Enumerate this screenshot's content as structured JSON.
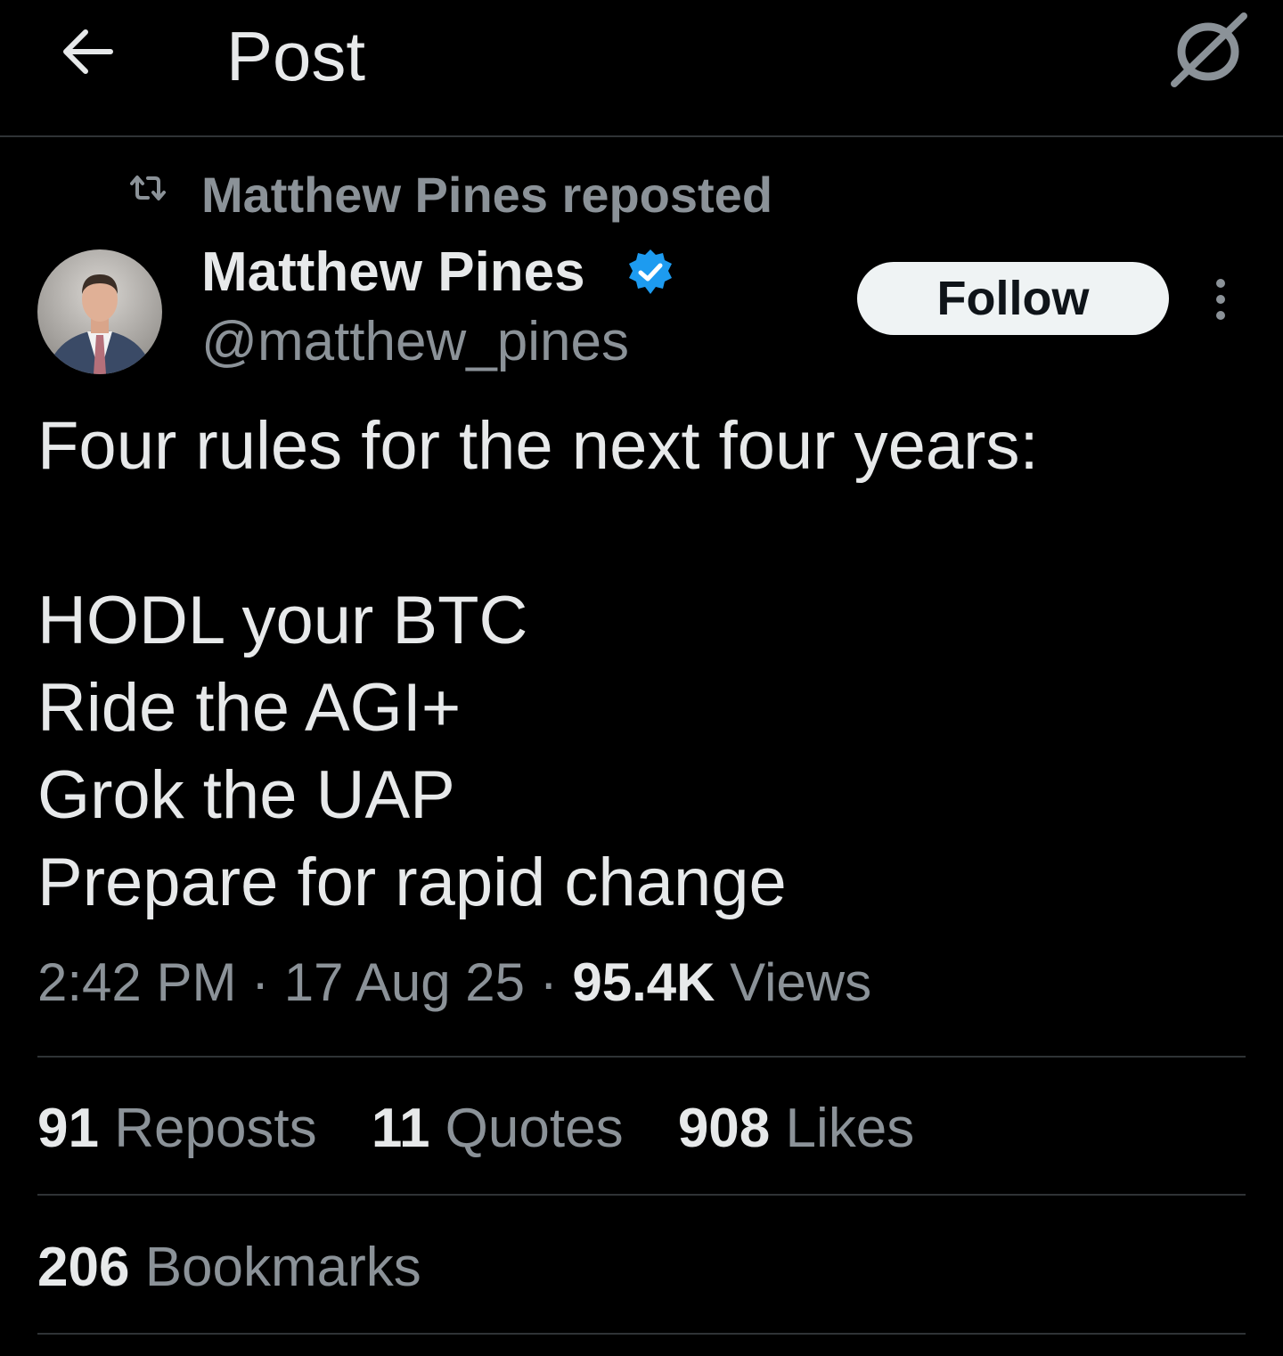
{
  "header": {
    "title": "Post",
    "back_icon": "arrow-left-icon",
    "grok_icon": "grok-icon"
  },
  "repost": {
    "icon": "repost-icon",
    "text": "Matthew Pines reposted"
  },
  "author": {
    "name": "Matthew Pines",
    "handle": "@matthew_pines",
    "verified": true,
    "verified_color": "#1d9bf0"
  },
  "follow_button": {
    "label": "Follow"
  },
  "post": {
    "lines": [
      "Four rules for the next four years:",
      "",
      "HODL your BTC",
      "Ride the AGI+",
      "Grok the UAP",
      "Prepare for rapid change"
    ]
  },
  "meta": {
    "time": "2:42 PM",
    "separator": "·",
    "date": "17 Aug 25",
    "views_count": "95.4K",
    "views_label": "Views"
  },
  "stats": {
    "reposts_count": "91",
    "reposts_label": "Reposts",
    "quotes_count": "11",
    "quotes_label": "Quotes",
    "likes_count": "908",
    "likes_label": "Likes",
    "bookmarks_count": "206",
    "bookmarks_label": "Bookmarks"
  },
  "colors": {
    "background": "#000000",
    "text_primary": "#e7e9ea",
    "text_secondary": "#8b9298",
    "divider": "#2f3336",
    "follow_bg": "#eff3f4"
  }
}
